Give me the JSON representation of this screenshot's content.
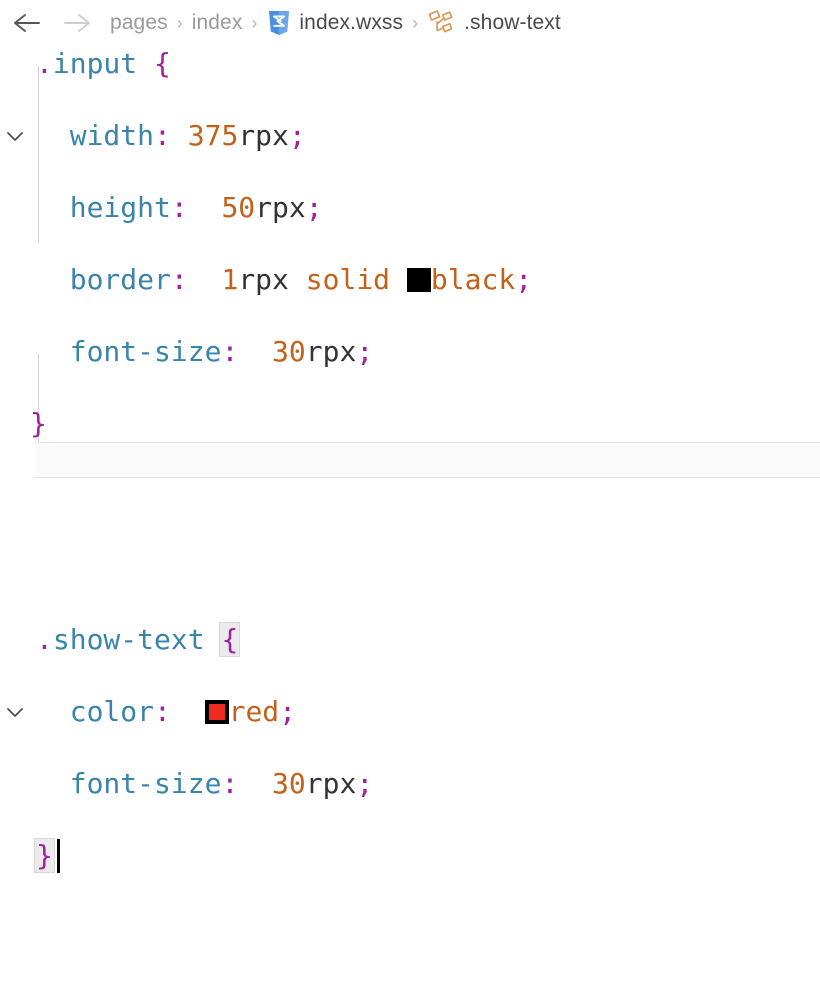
{
  "breadcrumb": {
    "back_icon": "arrow-left-icon",
    "forward_icon": "arrow-right-icon",
    "separator": "›",
    "items": [
      {
        "label": "pages",
        "icon": null,
        "tone": "muted"
      },
      {
        "label": "index",
        "icon": null,
        "tone": "muted"
      },
      {
        "label": "index.wxss",
        "icon": "css3-file-icon",
        "tone": "dark"
      },
      {
        "label": ".show-text",
        "icon": "css-selector-symbol-icon",
        "tone": "dark"
      }
    ]
  },
  "editor": {
    "language": "css",
    "fold_icon": "chevron-down-icon",
    "rules": [
      {
        "selector_dot": ".",
        "selector_name": "input",
        "open_brace": "{",
        "close_brace": "}",
        "declarations": [
          {
            "property": "width",
            "colon": ":",
            "value_number": "375",
            "value_unit": "rpx",
            "semicolon": ";"
          },
          {
            "property": "height",
            "colon": ":",
            "value_number": "50",
            "value_unit": "rpx",
            "semicolon": ";"
          },
          {
            "property": "border",
            "colon": ":",
            "value_number": "1",
            "value_unit": "rpx",
            "keyword_style": "solid",
            "swatch": "#000000",
            "keyword_color": "black",
            "semicolon": ";"
          },
          {
            "property": "font-size",
            "colon": ":",
            "value_number": "30",
            "value_unit": "rpx",
            "semicolon": ";"
          }
        ]
      },
      {
        "selector_dot": ".",
        "selector_name": "show-text",
        "open_brace": "{",
        "close_brace": "}",
        "declarations": [
          {
            "property": "color",
            "colon": ":",
            "swatch": "#ee2b1e",
            "keyword_color": "red",
            "semicolon": ";"
          },
          {
            "property": "font-size",
            "colon": ":",
            "value_number": "30",
            "value_unit": "rpx",
            "semicolon": ";"
          }
        ]
      }
    ]
  },
  "colors": {
    "selector": "#3a84ab",
    "property": "#3a84ab",
    "punctuation": "#a0209e",
    "number": "#c2621a",
    "keyword": "#c2621a",
    "unit": "#333333",
    "swatch_black": "#000000",
    "swatch_red": "#ee2b1e",
    "current_line_bg": "#fbfbfb",
    "breadcrumb_muted": "#9a9a9a",
    "breadcrumb_dark": "#4a4a4a",
    "css_icon": "#4a90e2",
    "selector_icon": "#d79a5b"
  }
}
